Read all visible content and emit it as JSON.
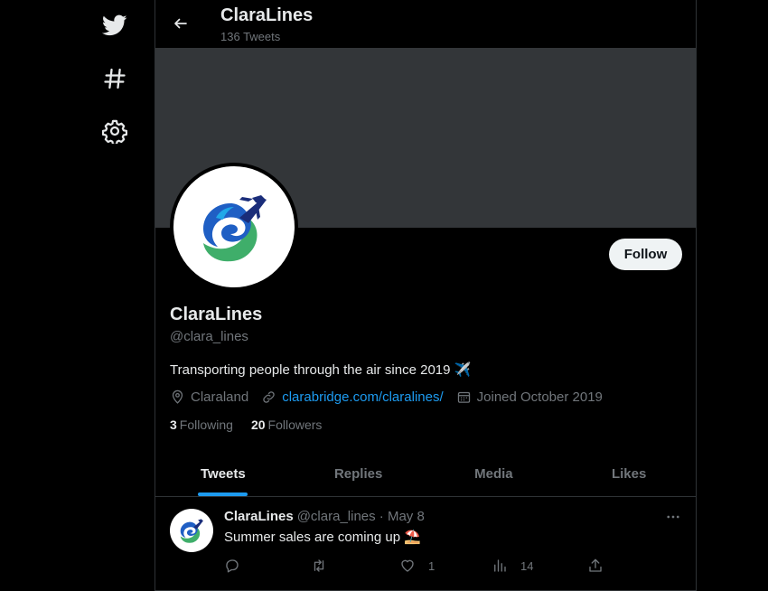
{
  "header": {
    "title": "ClaraLines",
    "subtitle": "136 Tweets"
  },
  "profile": {
    "name": "ClaraLines",
    "handle": "@clara_lines",
    "bio": "Transporting people through the air since 2019 ✈️",
    "location": "Claraland",
    "website": "clarabridge.com/claralines/",
    "joined": "Joined October 2019",
    "following_count": "3",
    "following_label": "Following",
    "followers_count": "20",
    "followers_label": "Followers",
    "follow_label": "Follow"
  },
  "tabs": [
    {
      "label": "Tweets"
    },
    {
      "label": "Replies"
    },
    {
      "label": "Media"
    },
    {
      "label": "Likes"
    }
  ],
  "tweet": {
    "name": "ClaraLines",
    "meta": "@clara_lines · May 8",
    "text": "Summer sales are coming up ⛱️",
    "likes": "1",
    "views": "14"
  },
  "sidebar": {
    "icons": [
      "twitter-bird-icon",
      "hashtag-icon",
      "gear-icon"
    ]
  },
  "colors": {
    "accent": "#1d9bf0",
    "banner": "#333639",
    "background": "#000000",
    "muted_text": "#71767b"
  }
}
